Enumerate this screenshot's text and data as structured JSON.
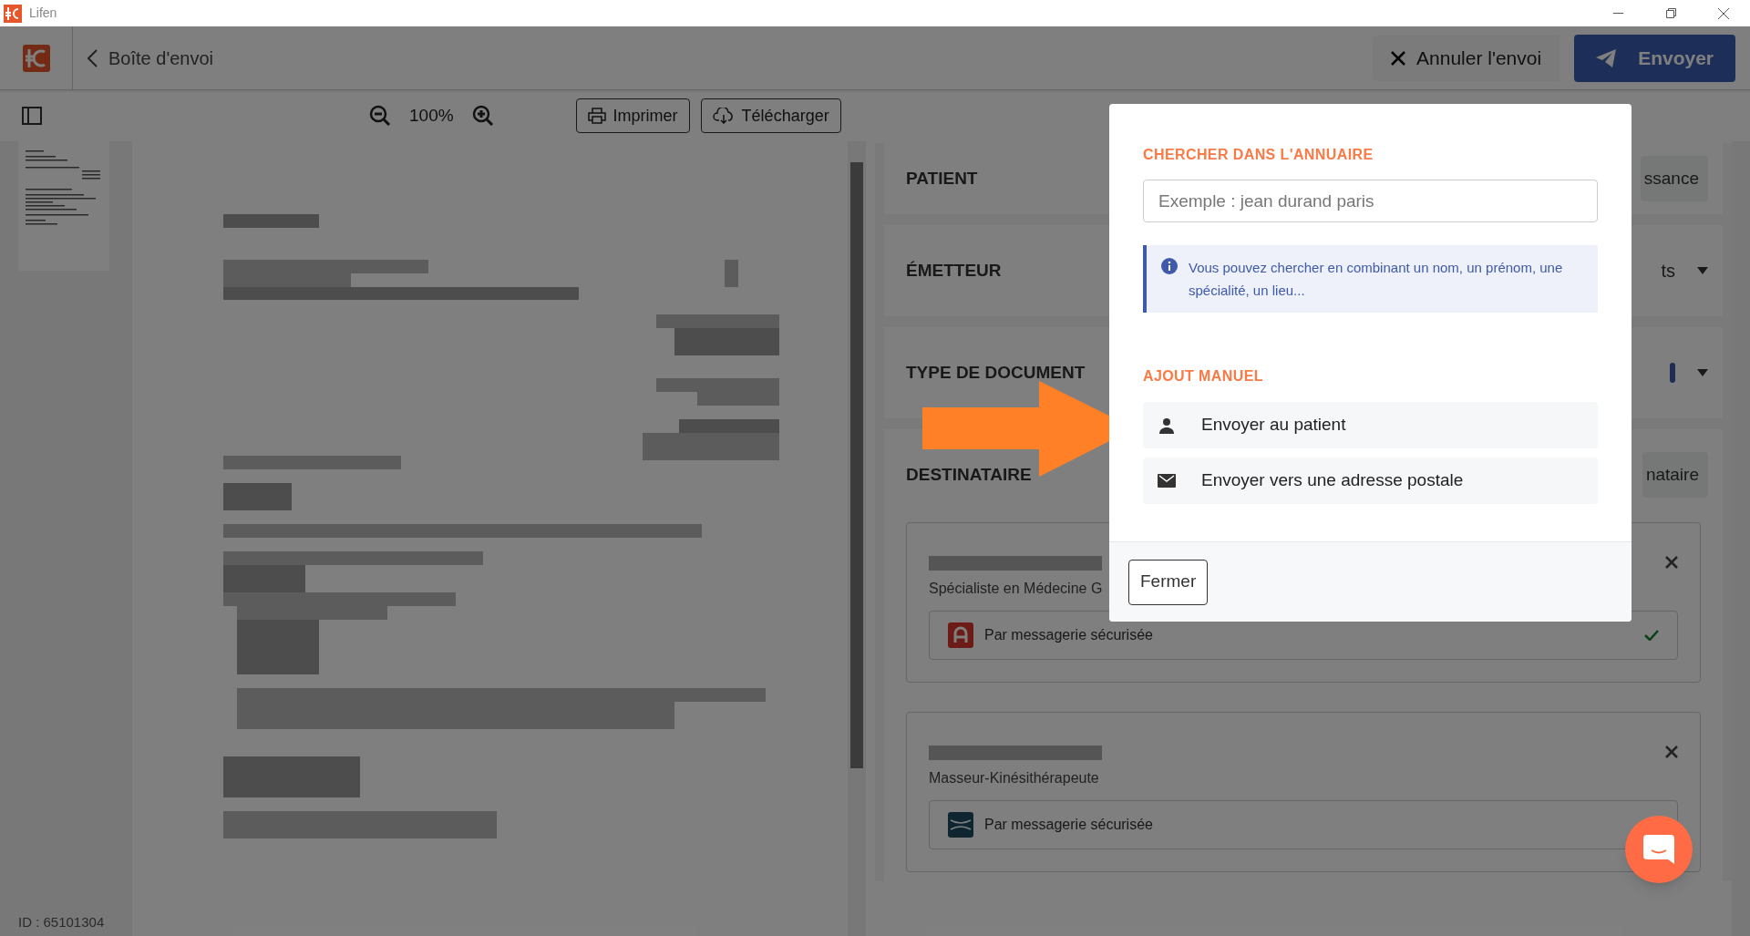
{
  "window": {
    "title": "Lifen"
  },
  "header": {
    "back_label": "Boîte d'envoi",
    "buttons": [
      {
        "label": "Annuler l'envoi",
        "kind": "secondary"
      },
      {
        "label": "Envoyer",
        "kind": "primary"
      }
    ]
  },
  "toolbar": {
    "zoom": "100%",
    "buttons": [
      {
        "label": "Imprimer",
        "kind": "print"
      },
      {
        "label": "Télécharger",
        "kind": "download"
      }
    ]
  },
  "document": {
    "id": "ID : 65101304"
  },
  "form": {
    "sections": [
      {
        "title": "PATIENT",
        "kind": "button",
        "action": "ssance"
      },
      {
        "title": "ÉMETTEUR",
        "kind": "dropdown",
        "action": "ts"
      },
      {
        "title": "TYPE DE DOCUMENT",
        "kind": "dropdown"
      },
      {
        "title": "DESTINATAIRE",
        "kind": "button",
        "action": "nataire"
      }
    ],
    "recipients": [
      {
        "specialty": "Spécialiste en Médecine G",
        "channel": "Par messagerie sécurisée",
        "kind": "red-logo",
        "verified": true
      },
      {
        "specialty": "Masseur-Kinésithérapeute",
        "channel": "Par messagerie sécurisée",
        "kind": "wave-logo"
      }
    ]
  },
  "dialog": {
    "search_heading": "CHERCHER DANS L'ANNUAIRE",
    "search": {
      "placeholder": "Exemple : jean durand paris"
    },
    "info": "Vous pouvez chercher en combinant un nom, un prénom, une spécialité, un lieu...",
    "manual_heading": "AJOUT MANUEL",
    "options": [
      {
        "label": "Envoyer au patient",
        "kind": "person"
      },
      {
        "label": "Envoyer vers une adresse postale",
        "kind": "mail"
      }
    ],
    "close": "Fermer"
  }
}
